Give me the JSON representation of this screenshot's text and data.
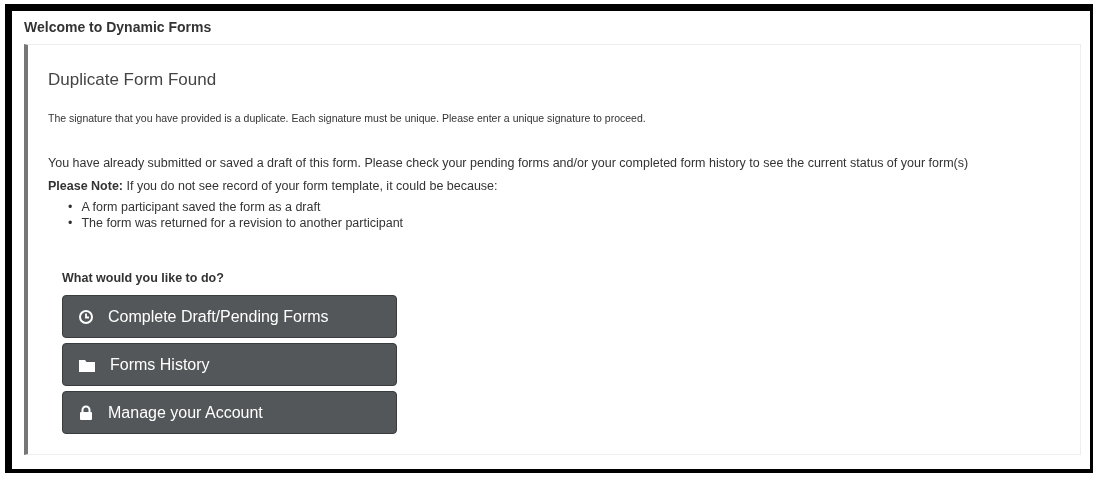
{
  "header": {
    "title": "Welcome to Dynamic Forms"
  },
  "panel": {
    "title": "Duplicate Form Found",
    "notice": "The signature that you have provided is a duplicate. Each signature must be unique. Please enter a unique signature to proceed.",
    "message": "You have already submitted or saved a draft of this form. Please check your pending forms and/or your completed form history to see the current status of your form(s)",
    "note": "**Please Note:** If you do not see record of your form template, it could be because:",
    "reasons": [
      {
        "bullet": "•",
        "text": "A form participant saved the form as a draft"
      },
      {
        "bullet": "•",
        "text": "The form was returned for a revision to another participant"
      }
    ],
    "prompt": "What would you like to do?",
    "actions": [
      {
        "label": "Complete Draft/Pending Forms",
        "kind": "pending"
      },
      {
        "label": "Forms History",
        "kind": "history"
      },
      {
        "label": "Manage your Account",
        "kind": "account"
      }
    ]
  }
}
